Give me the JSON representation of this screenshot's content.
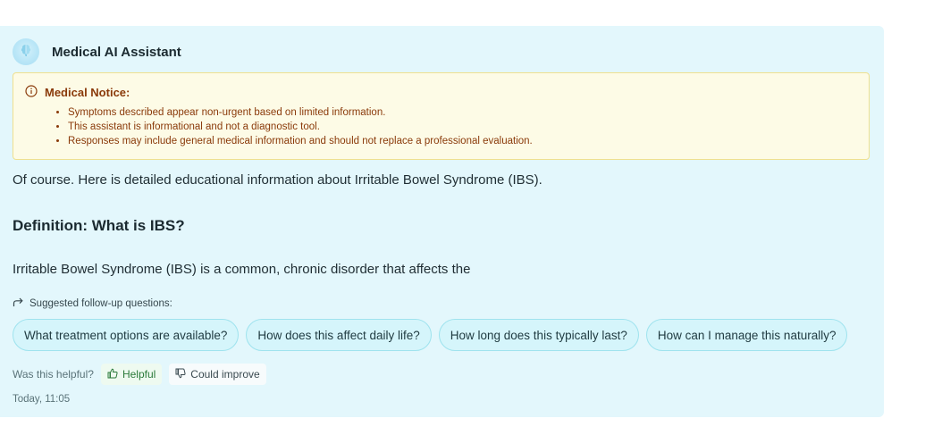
{
  "header": {
    "title": "Medical AI Assistant",
    "avatar_icon": "brain-icon"
  },
  "notice": {
    "icon": "info-icon",
    "title": "Medical Notice:",
    "items": [
      "Symptoms described appear non-urgent based on limited information.",
      "This assistant is informational and not a diagnostic tool.",
      "Responses may include general medical information and should not replace a professional evaluation."
    ],
    "colors": {
      "background": "#fdfbe6",
      "border": "#efe08f",
      "text": "#8a3a0a"
    }
  },
  "message": {
    "intro": "Of course. Here is detailed educational information about Irritable Bowel Syndrome (IBS).",
    "section_title": "Definition: What is IBS?",
    "paragraph": "Irritable Bowel Syndrome (IBS) is a common, chronic disorder that affects the"
  },
  "followups": {
    "label": "Suggested follow-up questions:",
    "icon": "share-arrow-icon",
    "questions": [
      "What treatment options are available?",
      "How does this affect daily life?",
      "How long does this typically last?",
      "How can I manage this naturally?"
    ]
  },
  "feedback": {
    "label": "Was this helpful?",
    "helpful_label": "Helpful",
    "improve_label": "Could improve"
  },
  "timestamp": "Today, 11:05",
  "colors": {
    "card_background": "#e3f7fc",
    "chip_background": "#d5f5fb",
    "chip_border": "#9fe3ee",
    "helpful_text": "#2b7a3a"
  }
}
